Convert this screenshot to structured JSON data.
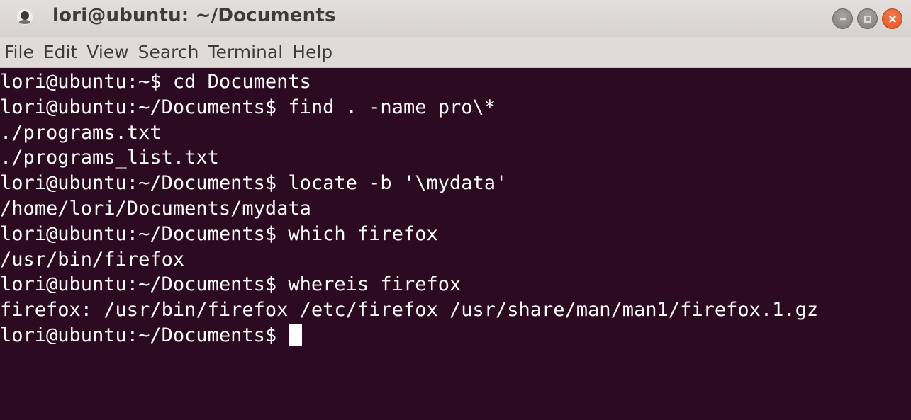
{
  "window": {
    "title": "lori@ubuntu: ~/Documents",
    "controls": [
      {
        "name": "minimize",
        "icon": "minimize-icon",
        "symbol": "−"
      },
      {
        "name": "maximize",
        "icon": "maximize-icon",
        "symbol": "□"
      },
      {
        "name": "close",
        "icon": "close-icon",
        "symbol": "×"
      }
    ]
  },
  "menubar": {
    "items": [
      "File",
      "Edit",
      "View",
      "Search",
      "Terminal",
      "Help"
    ]
  },
  "terminal": {
    "lines": [
      "lori@ubuntu:~$ cd Documents",
      "lori@ubuntu:~/Documents$ find . -name pro\\*",
      "./programs.txt",
      "./programs_list.txt",
      "lori@ubuntu:~/Documents$ locate -b '\\mydata'",
      "/home/lori/Documents/mydata",
      "lori@ubuntu:~/Documents$ which firefox",
      "/usr/bin/firefox",
      "lori@ubuntu:~/Documents$ whereis firefox",
      "firefox: /usr/bin/firefox /etc/firefox /usr/share/man/man1/firefox.1.gz"
    ],
    "current_prompt": "lori@ubuntu:~/Documents$ "
  },
  "colors": {
    "terminal_background": "#2c0a22",
    "terminal_text": "#ffffff",
    "titlebar": "#dfdcd8",
    "close_button": "#e95420"
  }
}
